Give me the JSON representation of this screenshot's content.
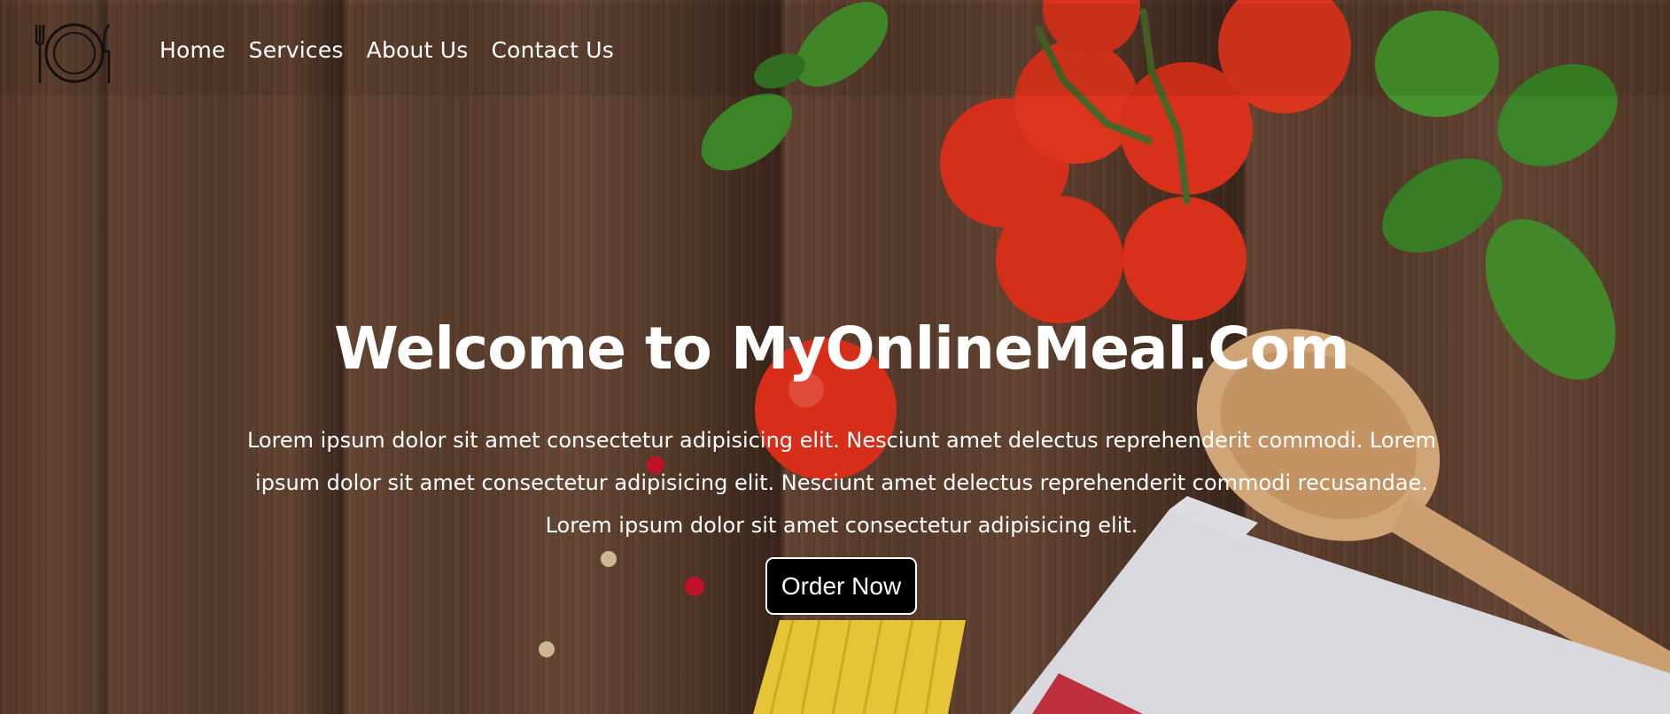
{
  "page": {
    "background_colors": {
      "wood_dark": "#3e291e",
      "wood_mid": "#5a3c2c",
      "wood_light": "#6b4a37",
      "tomato": "#e8321e",
      "basil": "#3f8c2a",
      "spoon": "#dcae7e",
      "cloth": "#e9e9ee",
      "pasta": "#f2cf3c"
    }
  },
  "navbar": {
    "logo_icon": "plate-fork-knife-icon",
    "links": [
      {
        "label": "Home"
      },
      {
        "label": "Services"
      },
      {
        "label": "About Us"
      },
      {
        "label": "Contact Us"
      }
    ]
  },
  "hero": {
    "title": "Welcome to MyOnlineMeal.Com",
    "description": "Lorem ipsum dolor sit amet consectetur adipisicing elit. Nesciunt amet delectus reprehenderit commodi. Lorem ipsum dolor sit amet consectetur adipisicing elit. Nesciunt amet delectus reprehenderit commodi recusandae. Lorem ipsum dolor sit amet consectetur adipisicing elit.",
    "cta_label": "Order Now",
    "cta_bg": "#000000",
    "cta_text_color": "#ffffff"
  }
}
